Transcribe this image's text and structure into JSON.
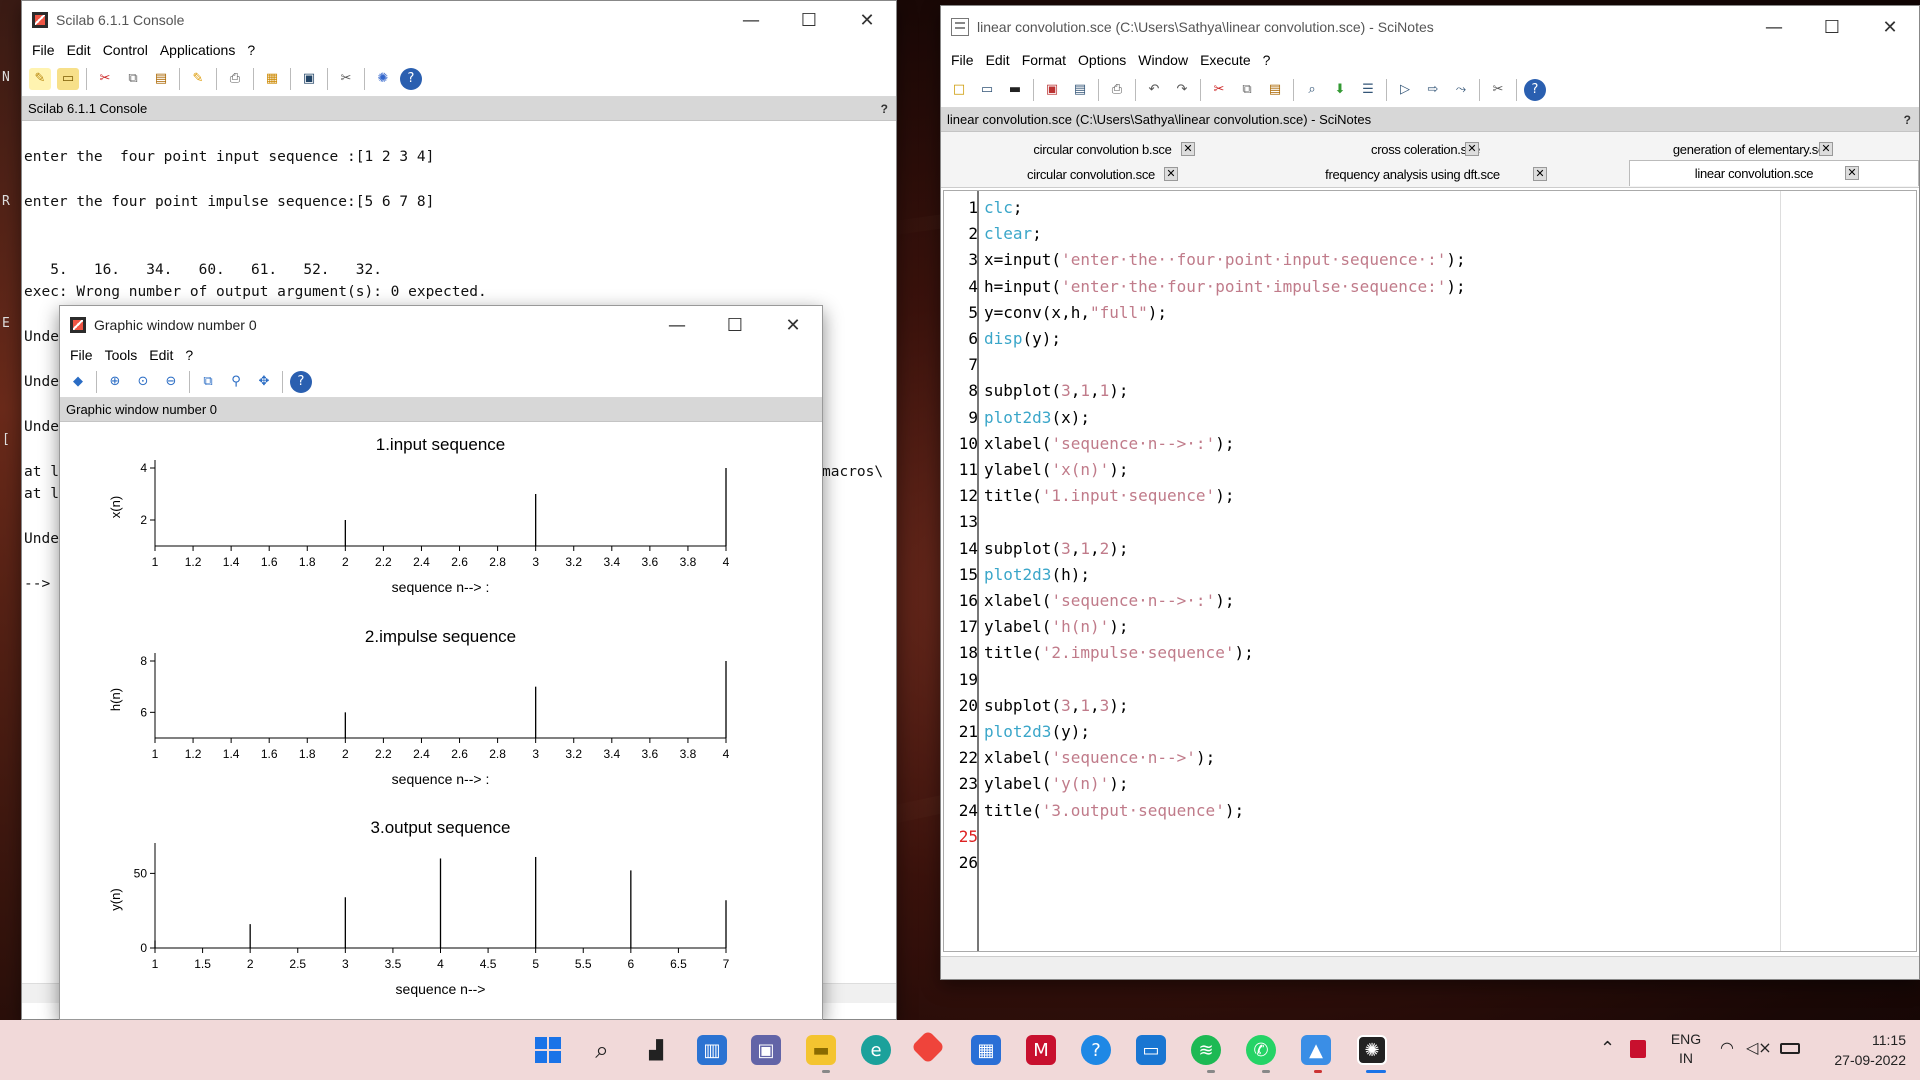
{
  "console_window": {
    "title": "Scilab 6.1.1 Console",
    "menu": [
      "File",
      "Edit",
      "Control",
      "Applications",
      "?"
    ],
    "panel_title": "Scilab 6.1.1 Console",
    "panel_help": "?",
    "lines": [
      "enter the  four point input sequence :[1 2 3 4]",
      "enter the four point impulse sequence:[5 6 7 8]",
      "   5.   16.   34.   60.   61.   52.   32.",
      "exec: Wrong number of output argument(s): 0 expected."
    ],
    "partial_lines": [
      "Unde",
      "Unde",
      "Unde",
      "at l",
      "at l",
      "Unde",
      "-->"
    ],
    "partial_right": "macros\\",
    "left_edge_chars": [
      "N",
      "R",
      "E",
      "["
    ]
  },
  "graphic_window": {
    "title": "Graphic window number 0",
    "menu": [
      "File",
      "Tools",
      "Edit",
      "?"
    ],
    "panel_title": "Graphic window number 0"
  },
  "chart_data": [
    {
      "type": "stem",
      "title": "1.input sequence",
      "xlabel": "sequence n--> :",
      "ylabel": "x(n)",
      "x": [
        1,
        2,
        3,
        4
      ],
      "y": [
        1,
        2,
        3,
        4
      ],
      "xlim": [
        1,
        4
      ],
      "ylim": [
        1,
        4
      ],
      "xticks": [
        "1",
        "1.2",
        "1.4",
        "1.6",
        "1.8",
        "2",
        "2.2",
        "2.4",
        "2.6",
        "2.8",
        "3",
        "3.2",
        "3.4",
        "3.6",
        "3.8",
        "4"
      ],
      "yticks": [
        "2",
        "4"
      ]
    },
    {
      "type": "stem",
      "title": "2.impulse sequence",
      "xlabel": "sequence n--> :",
      "ylabel": "h(n)",
      "x": [
        1,
        2,
        3,
        4
      ],
      "y": [
        5,
        6,
        7,
        8
      ],
      "xlim": [
        1,
        4
      ],
      "ylim": [
        5,
        8
      ],
      "xticks": [
        "1",
        "1.2",
        "1.4",
        "1.6",
        "1.8",
        "2",
        "2.2",
        "2.4",
        "2.6",
        "2.8",
        "3",
        "3.2",
        "3.4",
        "3.6",
        "3.8",
        "4"
      ],
      "yticks": [
        "6",
        "8"
      ]
    },
    {
      "type": "stem",
      "title": "3.output sequence",
      "xlabel": "sequence n-->",
      "ylabel": "y(n)",
      "x": [
        1,
        2,
        3,
        4,
        5,
        6,
        7
      ],
      "y": [
        5,
        16,
        34,
        60,
        61,
        52,
        32
      ],
      "xlim": [
        1,
        7
      ],
      "ylim": [
        0,
        65
      ],
      "xticks": [
        "1",
        "1.5",
        "2",
        "2.5",
        "3",
        "3.5",
        "4",
        "4.5",
        "5",
        "5.5",
        "6",
        "6.5",
        "7"
      ],
      "yticks": [
        "0",
        "50"
      ]
    }
  ],
  "scinotes_window": {
    "title": "linear convolution.sce (C:\\Users\\Sathya\\linear convolution.sce) - SciNotes",
    "menu": [
      "File",
      "Edit",
      "Format",
      "Options",
      "Window",
      "Execute",
      "?"
    ],
    "panel_title": "linear convolution.sce (C:\\Users\\Sathya\\linear convolution.sce) - SciNotes",
    "tabs_row1": [
      "circular convolution b.sce",
      "cross coleration.sce",
      "generation of elementary.sce"
    ],
    "tabs_row2": [
      "circular convolution.sce",
      "frequency analysis using dft.sce",
      "linear convolution.sce"
    ],
    "code": [
      [
        [
          "kw-cyan",
          "clc"
        ],
        [
          "kw-blk",
          ";"
        ]
      ],
      [
        [
          "kw-cyan",
          "clear"
        ],
        [
          "kw-blk",
          ";"
        ]
      ],
      [
        [
          "kw-blk",
          "x=input("
        ],
        [
          "str",
          "'enter·the··four·point·input·sequence·:'"
        ],
        [
          "kw-blk",
          ");"
        ]
      ],
      [
        [
          "kw-blk",
          "h=input("
        ],
        [
          "str",
          "'enter·the·four·point·impulse·sequence:'"
        ],
        [
          "kw-blk",
          ");"
        ]
      ],
      [
        [
          "kw-blk",
          "y=conv(x,h,"
        ],
        [
          "str",
          "\"full\""
        ],
        [
          "kw-blk",
          ");"
        ]
      ],
      [
        [
          "kw-cyan",
          "disp"
        ],
        [
          "kw-blk",
          "(y);"
        ]
      ],
      [],
      [
        [
          "kw-blk",
          "subplot("
        ],
        [
          "num",
          "3"
        ],
        [
          "kw-blk",
          ","
        ],
        [
          "num",
          "1"
        ],
        [
          "kw-blk",
          ","
        ],
        [
          "num",
          "1"
        ],
        [
          "kw-blk",
          ");"
        ]
      ],
      [
        [
          "kw-cyan",
          "plot2d3"
        ],
        [
          "kw-blk",
          "(x);"
        ]
      ],
      [
        [
          "kw-blk",
          "xlabel("
        ],
        [
          "str",
          "'sequence·n-->·:'"
        ],
        [
          "kw-blk",
          ");"
        ]
      ],
      [
        [
          "kw-blk",
          "ylabel("
        ],
        [
          "str",
          "'x(n)'"
        ],
        [
          "kw-blk",
          ");"
        ]
      ],
      [
        [
          "kw-blk",
          "title("
        ],
        [
          "str",
          "'1.input·sequence'"
        ],
        [
          "kw-blk",
          ");"
        ]
      ],
      [],
      [
        [
          "kw-blk",
          "subplot("
        ],
        [
          "num",
          "3"
        ],
        [
          "kw-blk",
          ","
        ],
        [
          "num",
          "1"
        ],
        [
          "kw-blk",
          ","
        ],
        [
          "num",
          "2"
        ],
        [
          "kw-blk",
          ");"
        ]
      ],
      [
        [
          "kw-cyan",
          "plot2d3"
        ],
        [
          "kw-blk",
          "(h);"
        ]
      ],
      [
        [
          "kw-blk",
          "xlabel("
        ],
        [
          "str",
          "'sequence·n-->·:'"
        ],
        [
          "kw-blk",
          ");"
        ]
      ],
      [
        [
          "kw-blk",
          "ylabel("
        ],
        [
          "str",
          "'h(n)'"
        ],
        [
          "kw-blk",
          ");"
        ]
      ],
      [
        [
          "kw-blk",
          "title("
        ],
        [
          "str",
          "'2.impulse·sequence'"
        ],
        [
          "kw-blk",
          ");"
        ]
      ],
      [],
      [
        [
          "kw-blk",
          "subplot("
        ],
        [
          "num",
          "3"
        ],
        [
          "kw-blk",
          ","
        ],
        [
          "num",
          "1"
        ],
        [
          "kw-blk",
          ","
        ],
        [
          "num",
          "3"
        ],
        [
          "kw-blk",
          ");"
        ]
      ],
      [
        [
          "kw-cyan",
          "plot2d3"
        ],
        [
          "kw-blk",
          "(y);"
        ]
      ],
      [
        [
          "kw-blk",
          "xlabel("
        ],
        [
          "str",
          "'sequence·n-->'"
        ],
        [
          "kw-blk",
          ");"
        ]
      ],
      [
        [
          "kw-blk",
          "ylabel("
        ],
        [
          "str",
          "'y(n)'"
        ],
        [
          "kw-blk",
          ");"
        ]
      ],
      [
        [
          "kw-blk",
          "title("
        ],
        [
          "str",
          "'3.output·sequence'"
        ],
        [
          "kw-blk",
          ");"
        ]
      ],
      [],
      []
    ],
    "line_numbers": [
      "1",
      "2",
      "3",
      "4",
      "5",
      "6",
      "7",
      "8",
      "9",
      "10",
      "11",
      "12",
      "13",
      "14",
      "15",
      "16",
      "17",
      "18",
      "19",
      "20",
      "21",
      "22",
      "23",
      "24",
      "25",
      "26"
    ],
    "current_line": "25"
  },
  "taskbar": {
    "lang": "ENG",
    "region": "IN",
    "time": "11:15",
    "date": "27-09-2022"
  },
  "window_controls": {
    "minimize": "—",
    "maximize": "☐",
    "close": "✕"
  }
}
